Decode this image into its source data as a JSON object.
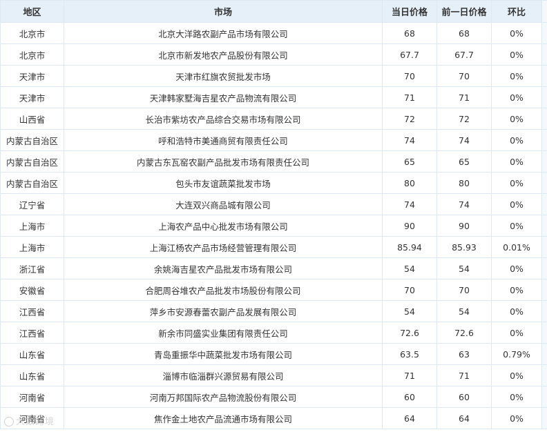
{
  "table": {
    "headers": {
      "region": "地区",
      "market": "市场",
      "today_price": "当日价格",
      "prev_price": "前一日价格",
      "ratio": "环比"
    },
    "rows": [
      {
        "region": "北京市",
        "market": "北京大洋路农副产品市场有限公司",
        "today": "68",
        "prev": "68",
        "ratio": "0%"
      },
      {
        "region": "北京市",
        "market": "北京市新发地农产品股份有限公司",
        "today": "67.7",
        "prev": "67.7",
        "ratio": "0%"
      },
      {
        "region": "天津市",
        "market": "天津市红旗农贸批发市场",
        "today": "70",
        "prev": "70",
        "ratio": "0%"
      },
      {
        "region": "天津市",
        "market": "天津韩家墅海吉星农产品物流有限公司",
        "today": "71",
        "prev": "71",
        "ratio": "0%"
      },
      {
        "region": "山西省",
        "market": "长治市紫坊农产品综合交易市场有限公司",
        "today": "72",
        "prev": "72",
        "ratio": "0%"
      },
      {
        "region": "内蒙古自治区",
        "market": "呼和浩特市美通商贸有限责任公司",
        "today": "74",
        "prev": "74",
        "ratio": "0%"
      },
      {
        "region": "内蒙古自治区",
        "market": "内蒙古东瓦窑农副产品批发市场有限责任公司",
        "today": "65",
        "prev": "65",
        "ratio": "0%"
      },
      {
        "region": "内蒙古自治区",
        "market": "包头市友谊蔬菜批发市场",
        "today": "80",
        "prev": "80",
        "ratio": "0%"
      },
      {
        "region": "辽宁省",
        "market": "大连双兴商品城有限公司",
        "today": "74",
        "prev": "74",
        "ratio": "0%"
      },
      {
        "region": "上海市",
        "market": "上海农产品中心批发市场有限公司",
        "today": "90",
        "prev": "90",
        "ratio": "0%"
      },
      {
        "region": "上海市",
        "market": "上海江杨农产品市场经营管理有限公司",
        "today": "85.94",
        "prev": "85.93",
        "ratio": "0.01%"
      },
      {
        "region": "浙江省",
        "market": "余姚海吉星农产品批发市场有限公司",
        "today": "54",
        "prev": "54",
        "ratio": "0%"
      },
      {
        "region": "安徽省",
        "market": "合肥周谷堆农产品批发市场股份有限公司",
        "today": "70",
        "prev": "70",
        "ratio": "0%"
      },
      {
        "region": "江西省",
        "market": "萍乡市安源春蕾农副产品发展有限公司",
        "today": "54",
        "prev": "54",
        "ratio": "0%"
      },
      {
        "region": "江西省",
        "market": "新余市同盛实业集团有限责任公司",
        "today": "72.6",
        "prev": "72.6",
        "ratio": "0%"
      },
      {
        "region": "山东省",
        "market": "青岛重振华中蔬菜批发市场有限公司",
        "today": "63.5",
        "prev": "63",
        "ratio": "0.79%"
      },
      {
        "region": "山东省",
        "market": "淄博市临淄群兴源贸易有限公司",
        "today": "71",
        "prev": "71",
        "ratio": "0%"
      },
      {
        "region": "河南省",
        "market": "河南万邦国际农产品物流股份有限公司",
        "today": "60",
        "prev": "60",
        "ratio": "0%"
      },
      {
        "region": "河南省",
        "market": "焦作金土地农产品流通市场有限公司",
        "today": "64",
        "prev": "64",
        "ratio": "0%"
      }
    ]
  },
  "watermark": {
    "text": "大数跨境",
    "icon": "circle-logo-icon"
  },
  "colors": {
    "header_bg": "#e6f0f9",
    "border": "#dde8f2",
    "text": "#333333"
  }
}
